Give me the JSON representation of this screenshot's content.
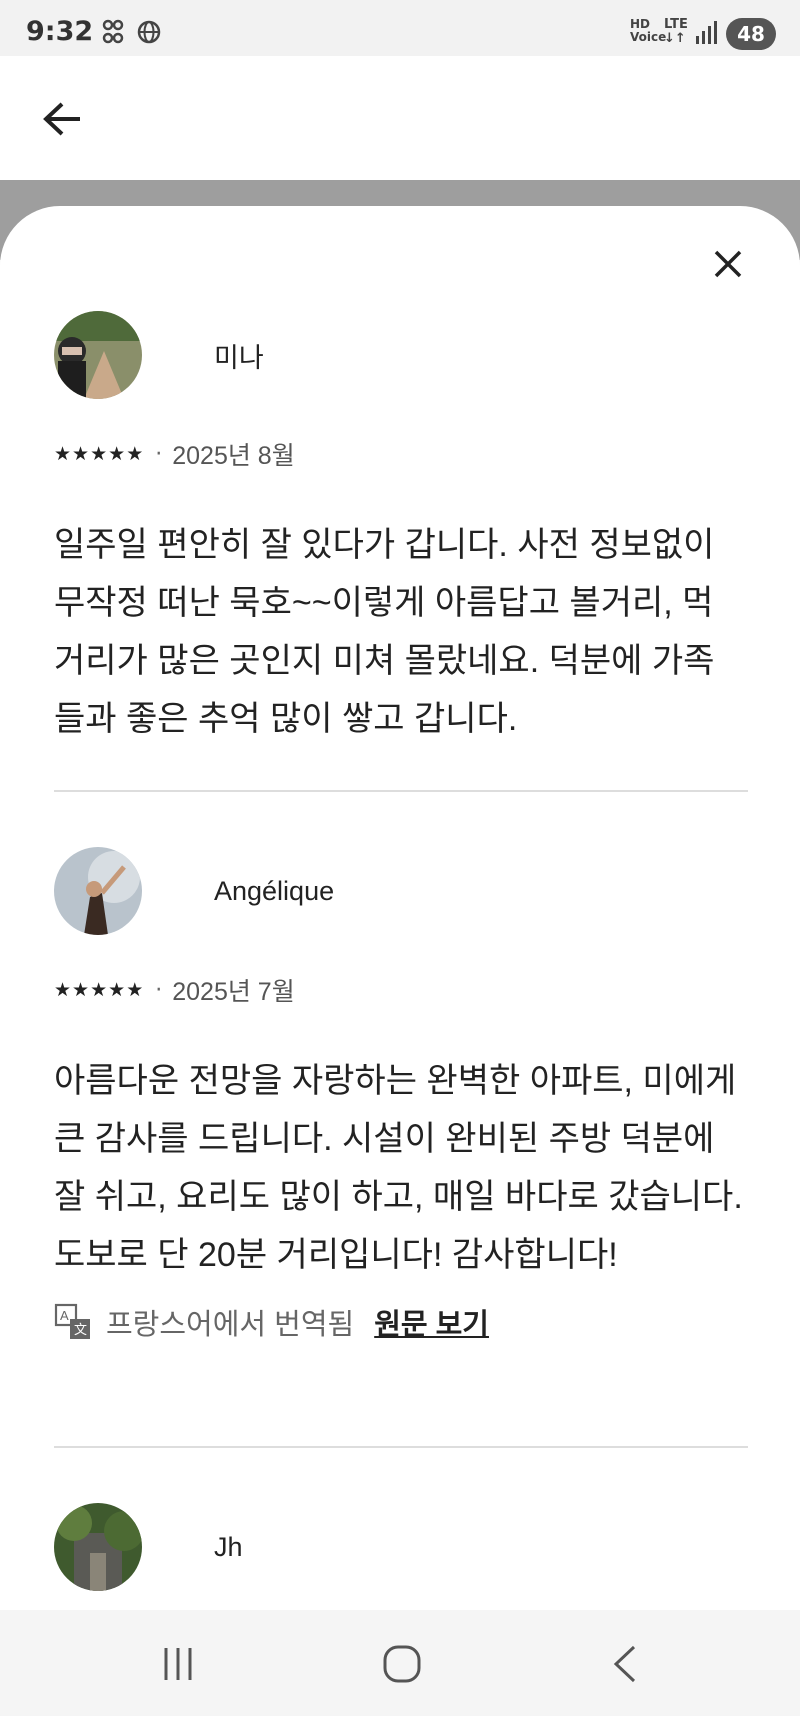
{
  "status_bar": {
    "time": "9:32",
    "battery": "48",
    "icons": [
      "link-icon",
      "globe-icon",
      "hd-voice-icon",
      "lte-icon",
      "signal-icon"
    ]
  },
  "header": {
    "back_icon": "arrow-left-icon"
  },
  "sheet": {
    "close_icon": "close-icon",
    "reviews": [
      {
        "name": "미나",
        "rating": 5,
        "date": "2025년 8월",
        "text": "일주일 편안히 잘 있다가 갑니다. 사전 정보없이 무작정 떠난 묵호~~이렇게 아름답고 볼거리, 먹거리가 많은 곳인지 미쳐 몰랐네요. 덕분에 가족들과 좋은 추억 많이 쌓고 갑니다."
      },
      {
        "name": "Angélique",
        "rating": 5,
        "date": "2025년 7월",
        "text": "아름다운 전망을 자랑하는 완벽한 아파트, 미에게 큰 감사를 드립니다. 시설이 완비된 주방 덕분에 잘 쉬고, 요리도 많이 하고, 매일 바다로 갔습니다. 도보로 단 20분 거리입니다! 감사합니다!",
        "translated_label": "프랑스어에서 번역됨",
        "original_link": "원문 보기"
      },
      {
        "name": "Jh"
      }
    ]
  },
  "nav_bar": {
    "buttons": [
      "recent-apps-icon",
      "home-icon",
      "back-icon"
    ]
  },
  "colors": {
    "background": "#f2f2f2",
    "sheet": "#ffffff",
    "overlay": "#9e9e9e",
    "text": "#222222",
    "divider": "#dddddd"
  }
}
